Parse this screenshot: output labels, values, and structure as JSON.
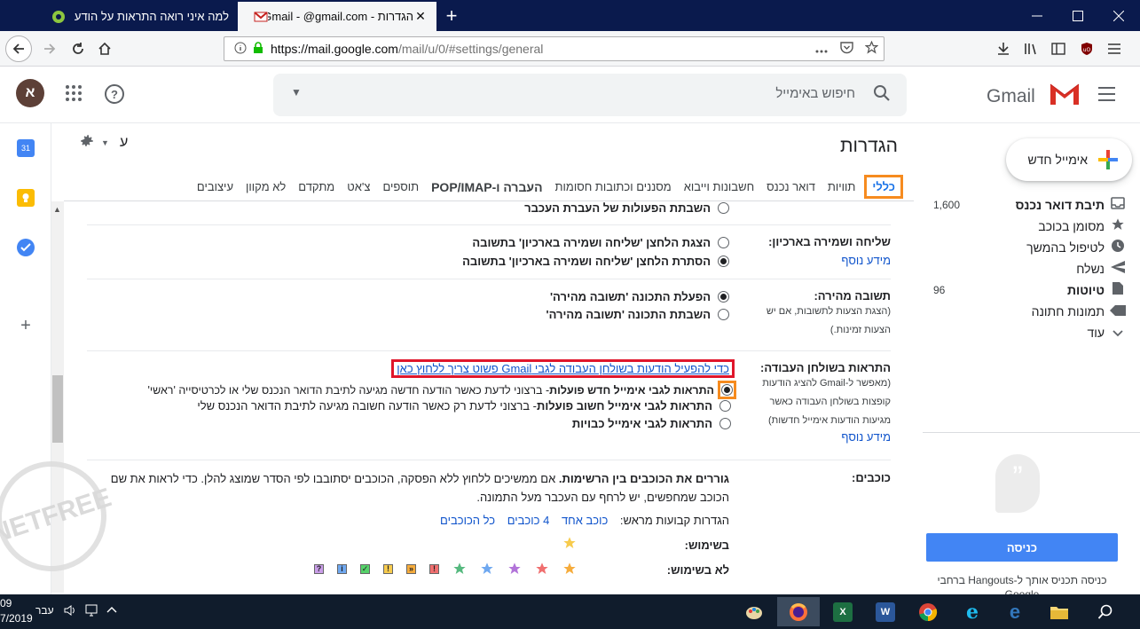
{
  "browser": {
    "tabs": [
      {
        "label": "למה איני רואה התראות על הודע",
        "active": false
      },
      {
        "label": "הגדרות - Gmail - @gmail.com",
        "active": true
      }
    ],
    "url_prefix": "https://mail.google.com",
    "url_path": "/mail/u/0/#settings/general",
    "close_glyph": "✕",
    "new_tab_glyph": "+"
  },
  "header": {
    "avatar_letter": "א",
    "search_placeholder": "חיפוש באימייל",
    "logo_text": "Gmail"
  },
  "settings": {
    "title": "הגדרות",
    "density_label": "ע",
    "tabs": [
      "כללי",
      "תוויות",
      "דואר נכנס",
      "חשבונות וייבוא",
      "מסננים וכתובות חסומות",
      "העברה ו-POP/IMAP",
      "תוספים",
      "צ'אט",
      "מתקדם",
      "לא מקוון",
      "עיצובים"
    ]
  },
  "rows": {
    "undo": {
      "option_off": "השבתת הפעולות של העברת העכבר"
    },
    "send_archive": {
      "label": "שליחה ושמירה בארכיון:",
      "more": "מידע נוסף",
      "opt_show": "הצגת הלחצן 'שליחה ושמירה בארכיון' בתשובה",
      "opt_hide": "הסתרת הלחצן 'שליחה ושמירה בארכיון' בתשובה"
    },
    "smart_reply": {
      "label": "תשובה מהירה:",
      "sub": "(הצגת הצעות לתשובות, אם יש הצעות זמינות.)",
      "opt_on": "הפעלת התכונה 'תשובה מהירה'",
      "opt_off": "השבתת התכונה 'תשובה מהירה'"
    },
    "desktop": {
      "label": "התראות בשולחן העבודה:",
      "sub": "(מאפשר ל-Gmail להציג הודעות קופצות בשולחן העבודה כאשר מגיעות הודעות אימייל חדשות)",
      "more": "מידע נוסף",
      "link": "כדי להפעיל הודעות בשולחן העבודה לגבי Gmail פשוט צריך ללחוץ כאן",
      "opt_new_bold": "התראות לגבי אימייל חדש פועלות",
      "opt_new_rest": " - ברצוני לדעת כאשר הודעה חדשה מגיעה לתיבת הדואר הנכנס שלי או לכרטיסייה 'ראשי'",
      "opt_imp_bold": "התראות לגבי אימייל חשוב פועלות",
      "opt_imp_rest": " - ברצוני לדעת רק כאשר הודעה חשובה מגיעה לתיבת הדואר הנכנס שלי",
      "opt_off_bold": "התראות לגבי אימייל כבויות"
    },
    "stars": {
      "label": "כוכבים:",
      "desc_bold": "גוררים את הכוכבים בין הרשימות.",
      "desc_rest": "  אם ממשיכים ללחוץ ללא הפסקה, הכוכבים יסתובבו לפי הסדר שמוצג להלן. כדי לראות את שם הכוכב שמחפשים, יש לרחף עם העכבר מעל התמונה.",
      "presets_label": "הגדרות קבועות מראש:",
      "preset_1": "כוכב אחד",
      "preset_4": "4 כוכבים",
      "preset_all": "כל הכוכבים",
      "in_use": "בשימוש:",
      "not_in_use": "לא בשימוש:"
    }
  },
  "nav": {
    "compose": "אימייל חדש",
    "items": [
      {
        "label": "תיבת דואר נכנס",
        "count": "1,600",
        "bold": true,
        "icon": "inbox-icon"
      },
      {
        "label": "מסומן בכוכב",
        "count": "",
        "bold": false,
        "icon": "star-icon"
      },
      {
        "label": "לטיפול בהמשך",
        "count": "",
        "bold": false,
        "icon": "clock-icon"
      },
      {
        "label": "נשלח",
        "count": "",
        "bold": false,
        "icon": "send-icon"
      },
      {
        "label": "טיוטות",
        "count": "96",
        "bold": true,
        "icon": "draft-icon"
      },
      {
        "label": "תמונות חתונה",
        "count": "",
        "bold": false,
        "icon": "label-icon"
      },
      {
        "label": "עוד",
        "count": "",
        "bold": false,
        "icon": "chevron-down-icon"
      }
    ]
  },
  "hangouts": {
    "signin": "כניסה",
    "text": "כניסה תכניס אותך ל-Hangouts ברחבי Google"
  },
  "taskbar": {
    "clock_top": "09",
    "clock_bottom": "7/2019",
    "lang": "עבר"
  },
  "watermark": "NETFREE",
  "colors": {
    "accent_blue": "#1a73e8",
    "red_outline": "#e0162b",
    "orange_outline": "#f68b1f",
    "signin_blue": "#4285f4"
  }
}
